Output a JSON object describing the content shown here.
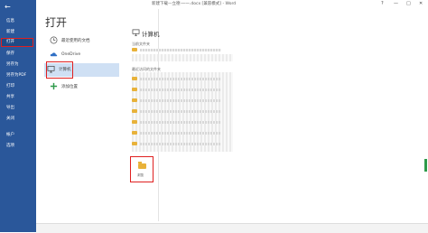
{
  "window": {
    "title": "新建下载—立德·一一.docx [兼容模式] - Word",
    "controls": [
      "?",
      "—",
      "□",
      "✕"
    ]
  },
  "sidebar": {
    "back": "←",
    "items": [
      {
        "label": "信息"
      },
      {
        "label": "新建"
      },
      {
        "label": "打开"
      },
      {
        "label": "保存"
      },
      {
        "label": "另存为"
      },
      {
        "label": "另存为PDF"
      },
      {
        "label": "打印"
      },
      {
        "label": "共享"
      },
      {
        "label": "导出"
      },
      {
        "label": "关闭"
      },
      {
        "label": "帐户"
      },
      {
        "label": "选项"
      }
    ]
  },
  "main": {
    "title": "打开",
    "locations": [
      {
        "label": "最近使用的文档",
        "icon": "clock-icon"
      },
      {
        "label": "OneDrive",
        "icon": "cloud-icon"
      },
      {
        "label": "计算机",
        "icon": "computer-icon"
      },
      {
        "label": "添加位置",
        "icon": "plus-icon"
      }
    ]
  },
  "right": {
    "title": "计算机",
    "current_folder_label": "当前文件夹",
    "recent_folders_label": "最近访问的文件夹",
    "browse_label": "浏览"
  },
  "colors": {
    "sidebar_bg": "#2a579a",
    "selected_bg": "#cfe0f4",
    "highlight_border": "#e02020",
    "folder": "#e8b23a"
  }
}
